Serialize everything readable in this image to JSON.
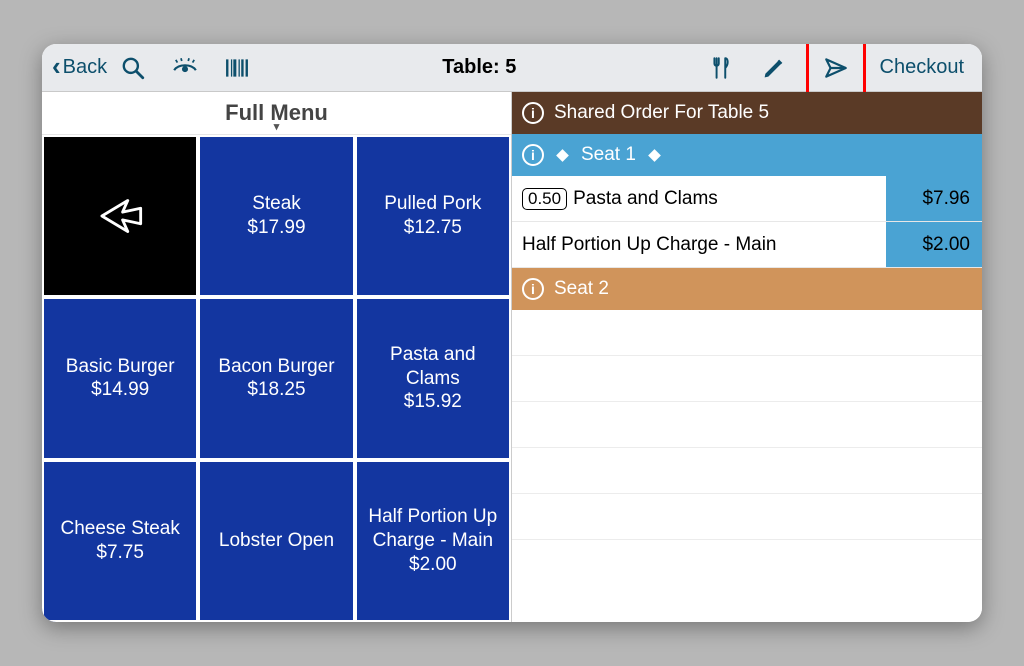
{
  "toolbar": {
    "back_label": "Back",
    "title": "Table: 5",
    "checkout_label": "Checkout"
  },
  "menu": {
    "header": "Full Menu",
    "items": [
      {
        "name": "",
        "price": ""
      },
      {
        "name": "Steak",
        "price": "$17.99"
      },
      {
        "name": "Pulled Pork",
        "price": "$12.75"
      },
      {
        "name": "Basic Burger",
        "price": "$14.99"
      },
      {
        "name": "Bacon Burger",
        "price": "$18.25"
      },
      {
        "name": "Pasta and Clams",
        "price": "$15.92"
      },
      {
        "name": "Cheese Steak",
        "price": "$7.75"
      },
      {
        "name": "Lobster Open",
        "price": ""
      },
      {
        "name": "Half Portion Up Charge - Main",
        "price": "$2.00"
      }
    ]
  },
  "order": {
    "shared_label": "Shared Order For Table 5",
    "seats": [
      {
        "label": "Seat 1",
        "lines": [
          {
            "qty": "0.50",
            "name": "Pasta and Clams",
            "price": "$7.96"
          },
          {
            "qty": "",
            "name": "Half Portion Up Charge - Main",
            "price": "$2.00"
          }
        ]
      },
      {
        "label": "Seat 2",
        "lines": []
      }
    ]
  }
}
